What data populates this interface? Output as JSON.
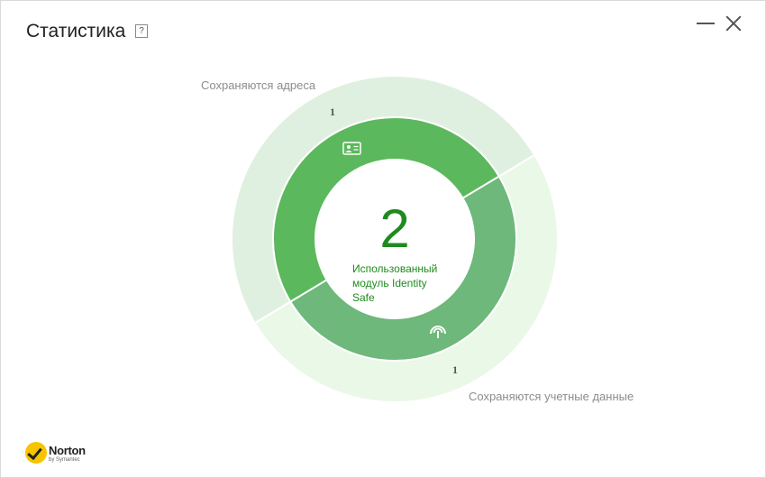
{
  "window": {
    "title": "Статистика",
    "help_label": "?"
  },
  "colors": {
    "outer_saved_addresses": "#dff0e0",
    "outer_saved_credentials": "#eaf8e7",
    "inner_saved_addresses": "#5cb85c",
    "inner_saved_credentials": "#6db87a",
    "accent_text": "#1e8b1e"
  },
  "chart_data": {
    "type": "pie",
    "center_value": "2",
    "center_label": "Использованный модуль Identity Safe",
    "segments": [
      {
        "name": "Сохраняются адреса",
        "value": 1,
        "icon": "address-card-icon"
      },
      {
        "name": "Сохраняются учетные данные",
        "value": 1,
        "icon": "credentials-icon"
      }
    ]
  },
  "logo": {
    "name": "Norton",
    "subtitle": "by Symantec"
  }
}
